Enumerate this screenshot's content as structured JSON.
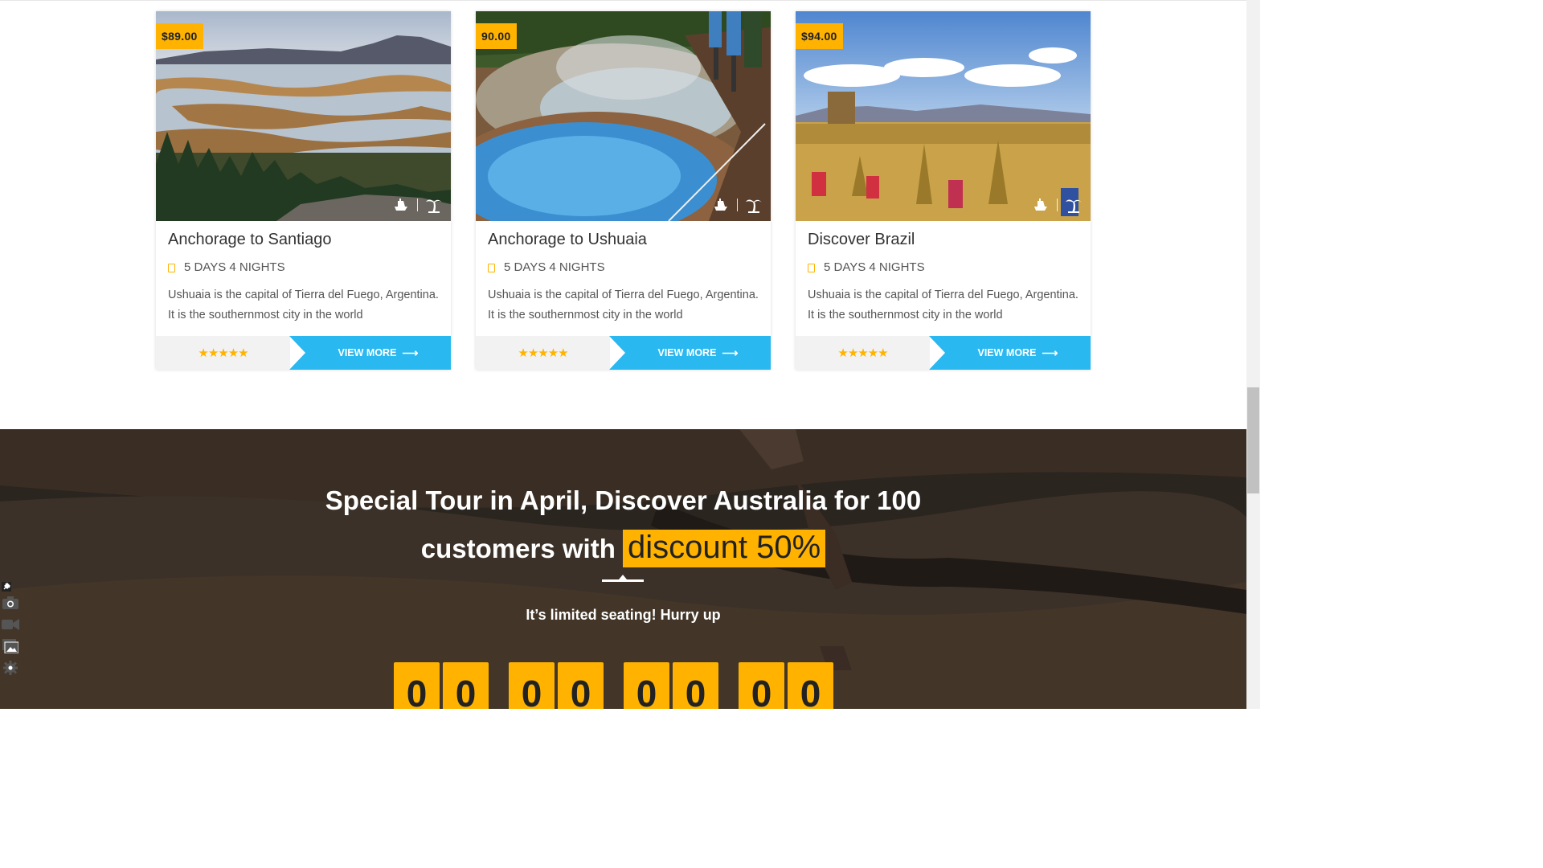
{
  "cards": [
    {
      "price": "$89.00",
      "title": "Anchorage to Santiago",
      "duration": "5 DAYS 4 NIGHTS",
      "description": "Ushuaia is the capital of Tierra del Fuego, Argentina. It is the southernmost city in the world",
      "rating": 5,
      "stars": "★★★★★",
      "button": "VIEW MORE",
      "icons": [
        "boat-icon",
        "palm-tree-icon"
      ]
    },
    {
      "price": "90.00",
      "title": "Anchorage to Ushuaia",
      "duration": "5 DAYS 4 NIGHTS",
      "description": "Ushuaia is the capital of Tierra del Fuego, Argentina. It is the southernmost city in the world",
      "rating": 5,
      "stars": "★★★★★",
      "button": "VIEW MORE",
      "icons": [
        "boat-icon",
        "palm-tree-icon"
      ]
    },
    {
      "price": "$94.00",
      "title": "Discover Brazil",
      "duration": "5 DAYS 4 NIGHTS",
      "description": "Ushuaia is the capital of Tierra del Fuego, Argentina. It is the southernmost city in the world",
      "rating": 5,
      "stars": "★★★★★",
      "button": "VIEW MORE",
      "icons": [
        "boat-icon",
        "palm-tree-icon"
      ]
    }
  ],
  "promo": {
    "title_line1": "Special Tour in April, Discover Australia for 100",
    "title_line2_prefix": "customers with",
    "highlight": "discount 50%",
    "subtitle": "It’s limited seating! Hurry up",
    "countdown_digits": [
      "0",
      "0",
      "0",
      "0",
      "0",
      "0",
      "0",
      "0"
    ]
  },
  "colors": {
    "accent": "#ffb300",
    "button": "#29b8f0",
    "promo_overlay": "#2b2520"
  },
  "side_tools": [
    "pin-icon",
    "camera-icon",
    "video-icon",
    "gallery-icon",
    "settings-icon"
  ]
}
